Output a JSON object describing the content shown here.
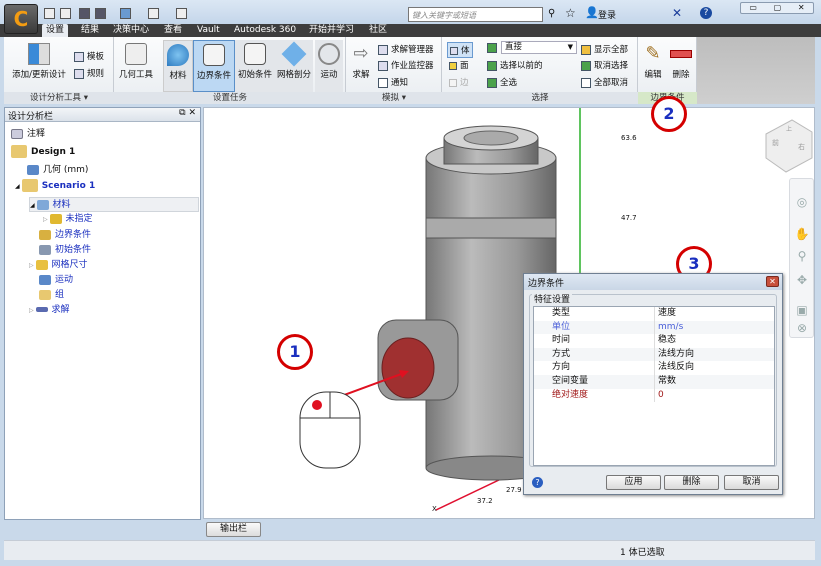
{
  "quick_access": {
    "search_placeholder": "键入关键字或短语",
    "login": "登录"
  },
  "tabs": [
    "设置",
    "结果",
    "决策中心",
    "查看",
    "Vault",
    "Autodesk 360",
    "开始并学习",
    "社区"
  ],
  "ribbon": {
    "groups": [
      {
        "label": "设计分析工具 ▾",
        "buttons": [
          "添加/更新设计",
          "模板",
          "规则"
        ]
      },
      {
        "label": "设置任务",
        "buttons": [
          "几何工具",
          "材料",
          "边界条件",
          "初始条件",
          "网格剖分",
          "运动"
        ]
      },
      {
        "label": "模拟 ▾",
        "buttons": [
          "求解",
          "求解管理器",
          "作业监控器",
          "通知"
        ]
      },
      {
        "label": "选择",
        "buttons": [
          "体",
          "面",
          "边",
          "直接",
          "选择以前的",
          "全选",
          "显示全部",
          "取消选择",
          "全部取消"
        ]
      },
      {
        "label": "边界条件",
        "buttons": [
          "编辑",
          "删除"
        ]
      }
    ]
  },
  "design_panel": {
    "title": "设计分析栏",
    "items": [
      "注释",
      "Design 1",
      "几何 (mm)",
      "Scenario 1",
      "材料",
      "未指定",
      "边界条件",
      "初始条件",
      "网格尺寸",
      "运动",
      "组",
      "求解"
    ]
  },
  "viewport": {
    "axis_labels": [
      "63.6",
      "47.7",
      "27.9",
      "37.2",
      "X"
    ],
    "view_cube": [
      "前",
      "右",
      "上"
    ]
  },
  "callouts": [
    "1",
    "2",
    "3"
  ],
  "dialog": {
    "title": "边界条件",
    "group": "特征设置",
    "rows": [
      {
        "key": "类型",
        "value": "速度",
        "color": "#111111"
      },
      {
        "key": "单位",
        "value": "mm/s",
        "color": "#4a5fd8"
      },
      {
        "key": "时间",
        "value": "稳态",
        "color": "#111111"
      },
      {
        "key": "方式",
        "value": "法线方向",
        "color": "#111111"
      },
      {
        "key": "方向",
        "value": "法线反向",
        "color": "#111111"
      },
      {
        "key": "空间变量",
        "value": "常数",
        "color": "#111111"
      },
      {
        "key": "绝对速度",
        "value": "0",
        "color": "#a01818"
      }
    ],
    "buttons": [
      "应用",
      "删除",
      "取消"
    ]
  },
  "output_bar": "输出栏",
  "status": "1 体已选取"
}
